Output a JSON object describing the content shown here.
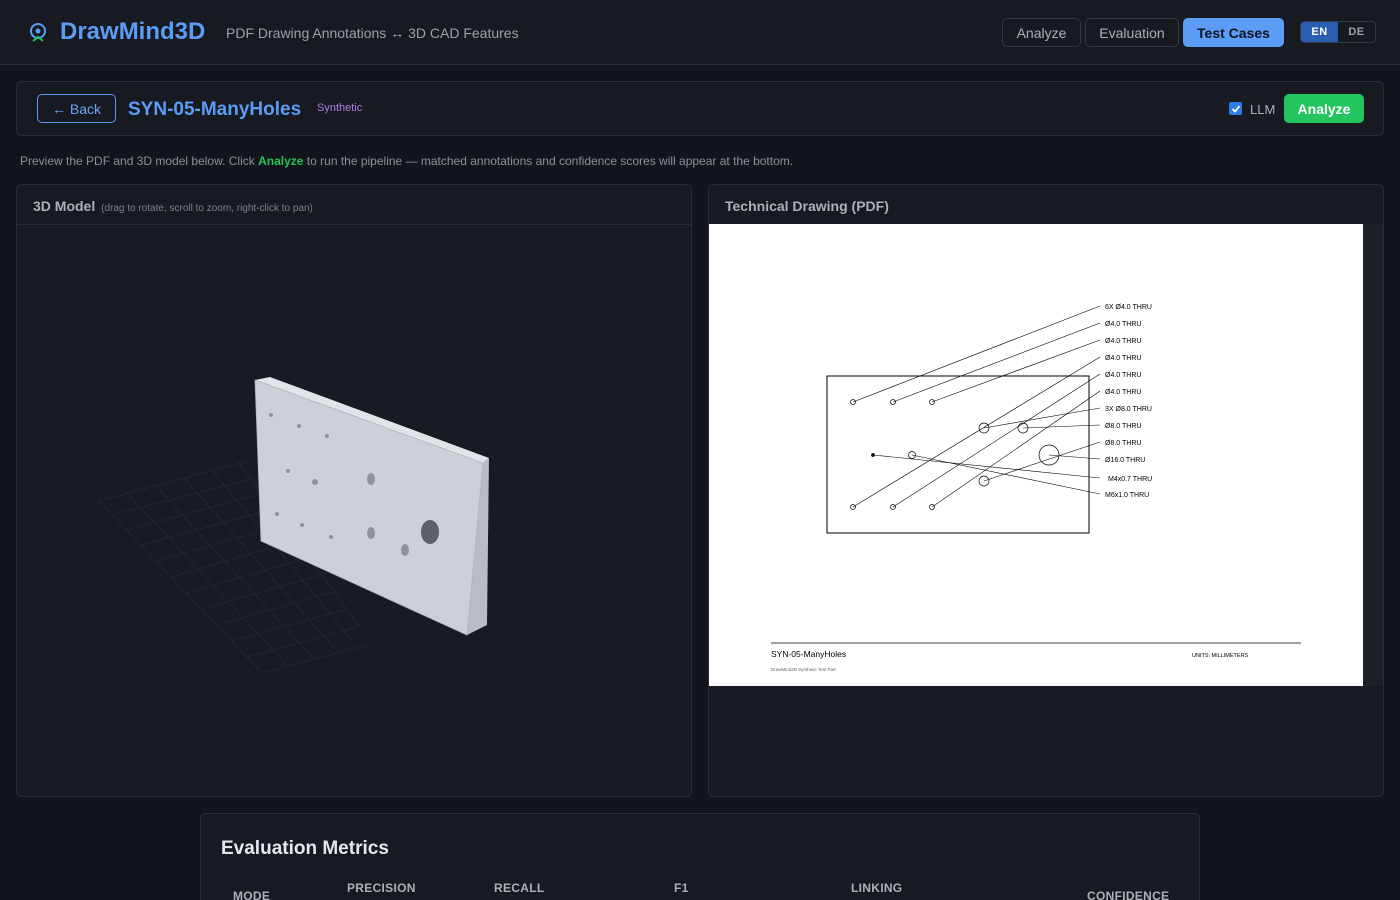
{
  "header": {
    "brand": "DrawMind3D",
    "tagline": "PDF Drawing Annotations ↔ 3D CAD Features",
    "nav": [
      "Analyze",
      "Evaluation",
      "Test Cases"
    ],
    "active_nav": "Test Cases",
    "languages": [
      "EN",
      "DE"
    ],
    "active_language": "EN",
    "accent_color": "#5b9cf5"
  },
  "casebar": {
    "back_label": "← Back",
    "title": "SYN-05-ManyHoles",
    "badge": "Synthetic",
    "llm_label": "LLM",
    "llm_checked": true,
    "analyze_label": "Analyze",
    "analyze_color": "#22c55e"
  },
  "hint": {
    "before": "Preview the PDF and 3D model below. Click ",
    "highlight": "Analyze",
    "after": " to run the pipeline — matched annotations and confidence scores will appear at the bottom."
  },
  "model_panel": {
    "title": "3D Model",
    "subtitle": "(drag to rotate, scroll to zoom, right-click to pan)"
  },
  "drawing_panel": {
    "title": "Technical Drawing (PDF)",
    "callouts": [
      "6X Ø4.0 THRU",
      "Ø4.0 THRU",
      "Ø4.0 THRU",
      "Ø4.0 THRU",
      "Ø4.0 THRU",
      "Ø4.0 THRU",
      "3X Ø8.0 THRU",
      "Ø8.0 THRU",
      "Ø8.0 THRU",
      "Ø16.0 THRU",
      "M4x0.7 THRU",
      "M6x1.0 THRU"
    ],
    "title_block_name": "SYN-05-ManyHoles",
    "title_block_footer": "DrawMind3D Synthetic Test Part",
    "units": "UNITS: MILLIMETERS"
  },
  "metrics": {
    "title": "Evaluation Metrics",
    "columns": [
      "MODE",
      "PRECISION",
      "RECALL",
      "F1",
      "LINKING",
      "CONFIDENCE"
    ]
  }
}
